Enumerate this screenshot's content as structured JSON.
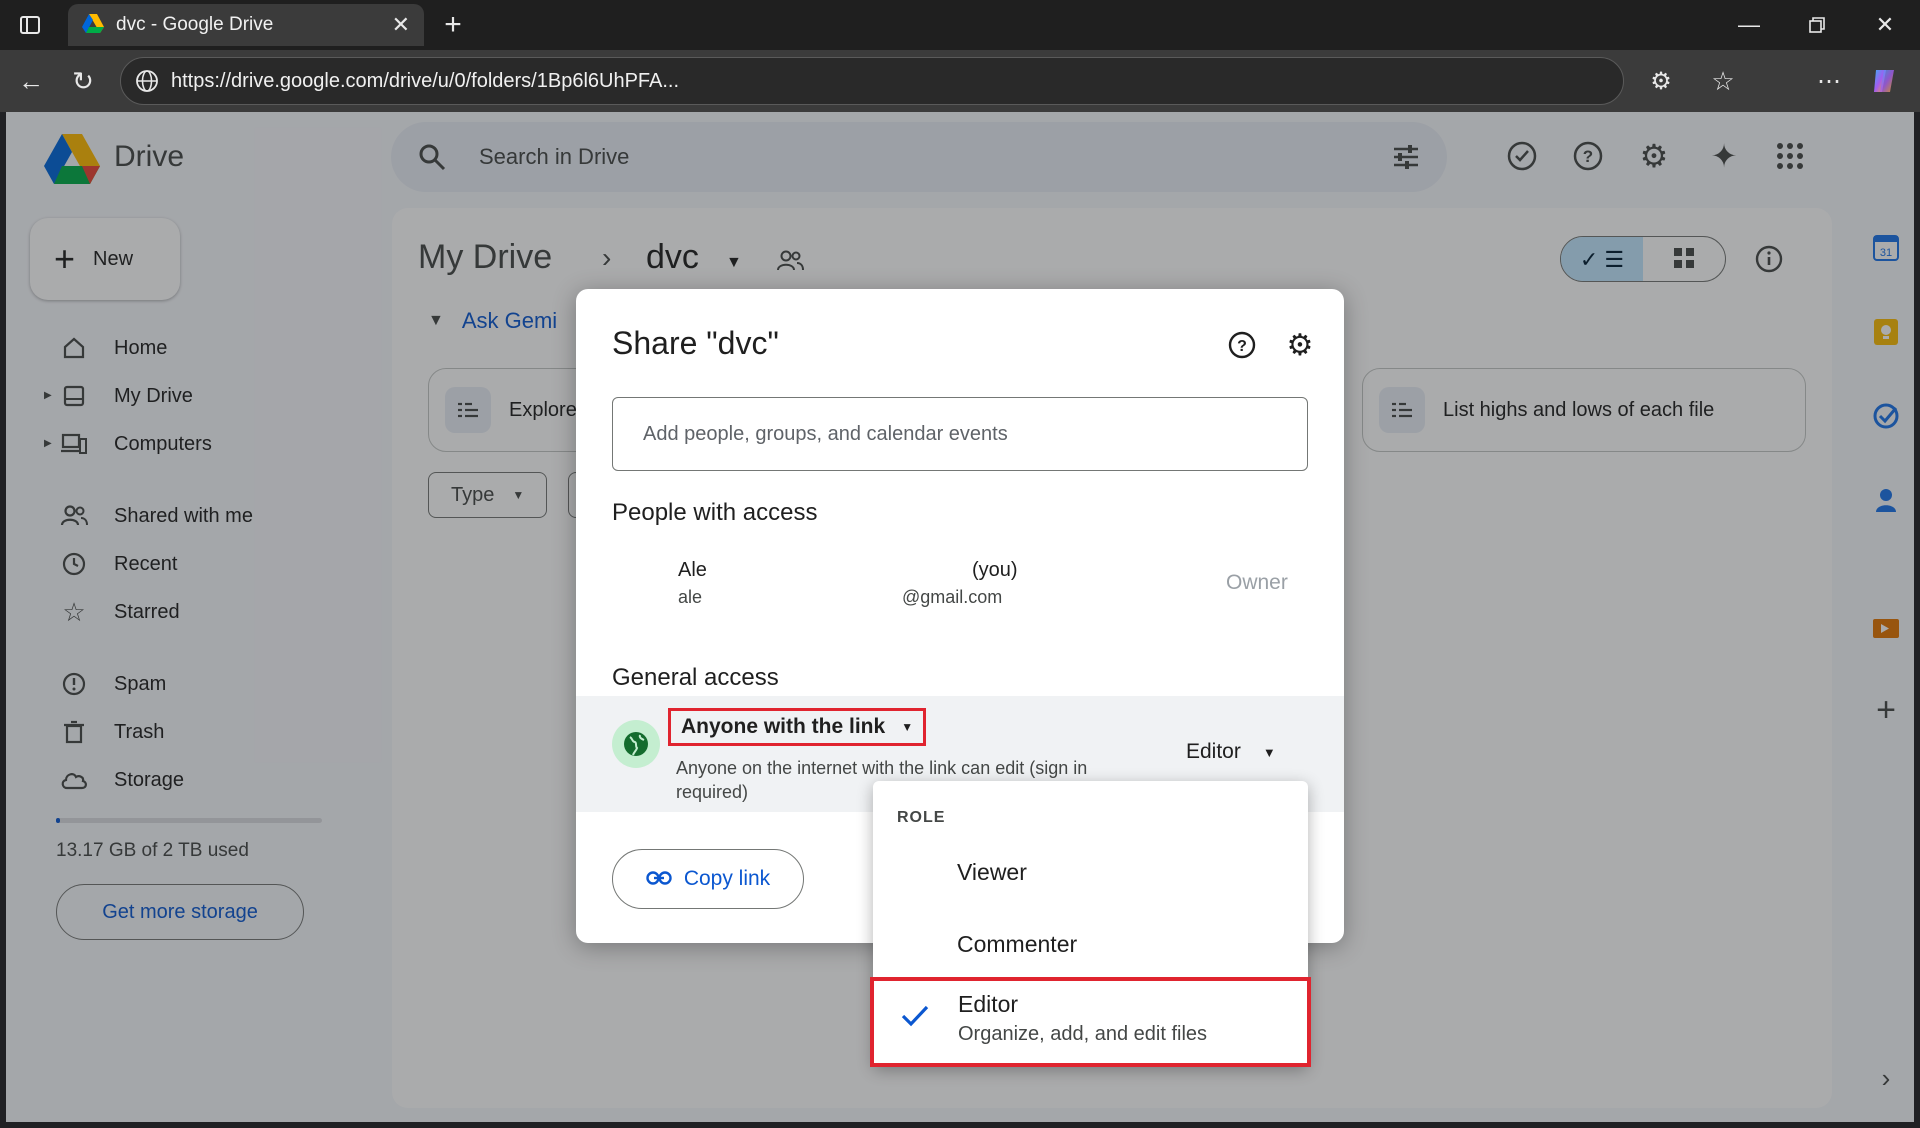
{
  "browser": {
    "tab_title": "dvc - Google Drive",
    "url": "https://drive.google.com/drive/u/0/folders/1Bp6l6UhPFA..."
  },
  "drive": {
    "logo_text": "Drive",
    "search_placeholder": "Search in Drive",
    "new_label": "New",
    "sidebar": [
      {
        "label": "Home",
        "icon": "home-icon"
      },
      {
        "label": "My Drive",
        "icon": "my-drive-icon"
      },
      {
        "label": "Computers",
        "icon": "computers-icon"
      },
      {
        "label": "Shared with me",
        "icon": "people-icon"
      },
      {
        "label": "Recent",
        "icon": "clock-icon"
      },
      {
        "label": "Starred",
        "icon": "star-icon"
      },
      {
        "label": "Spam",
        "icon": "spam-icon"
      },
      {
        "label": "Trash",
        "icon": "trash-icon"
      },
      {
        "label": "Storage",
        "icon": "cloud-icon"
      }
    ],
    "storage_text": "13.17 GB of 2 TB used",
    "storage_fraction": 0.0066,
    "get_storage_label": "Get more storage",
    "breadcrumb": {
      "root": "My Drive",
      "folder": "dvc"
    },
    "ask_gemini": "Ask Gemi",
    "chips": [
      "Explore",
      "List highs and lows of each file"
    ],
    "filters": [
      "Type"
    ]
  },
  "share_dialog": {
    "title": "Share \"dvc\"",
    "add_placeholder": "Add people, groups, and calendar events",
    "people_heading": "People with access",
    "person": {
      "name": "Ale",
      "you": "(you)",
      "email_a": "ale",
      "email_b": "@gmail.com",
      "role": "Owner"
    },
    "general_heading": "General access",
    "access_level": "Anyone with the link",
    "access_description": "Anyone on the internet with the link can edit (sign in required)",
    "role": "Editor",
    "copy_link_label": "Copy link"
  },
  "role_menu": {
    "header": "ROLE",
    "options": [
      {
        "label": "Viewer",
        "selected": false
      },
      {
        "label": "Commenter",
        "selected": false
      },
      {
        "label": "Editor",
        "description": "Organize, add, and edit files",
        "selected": true
      }
    ]
  },
  "colors": {
    "accent": "#0b57d0",
    "highlight": "#e0242f",
    "overlay": "#202124"
  }
}
